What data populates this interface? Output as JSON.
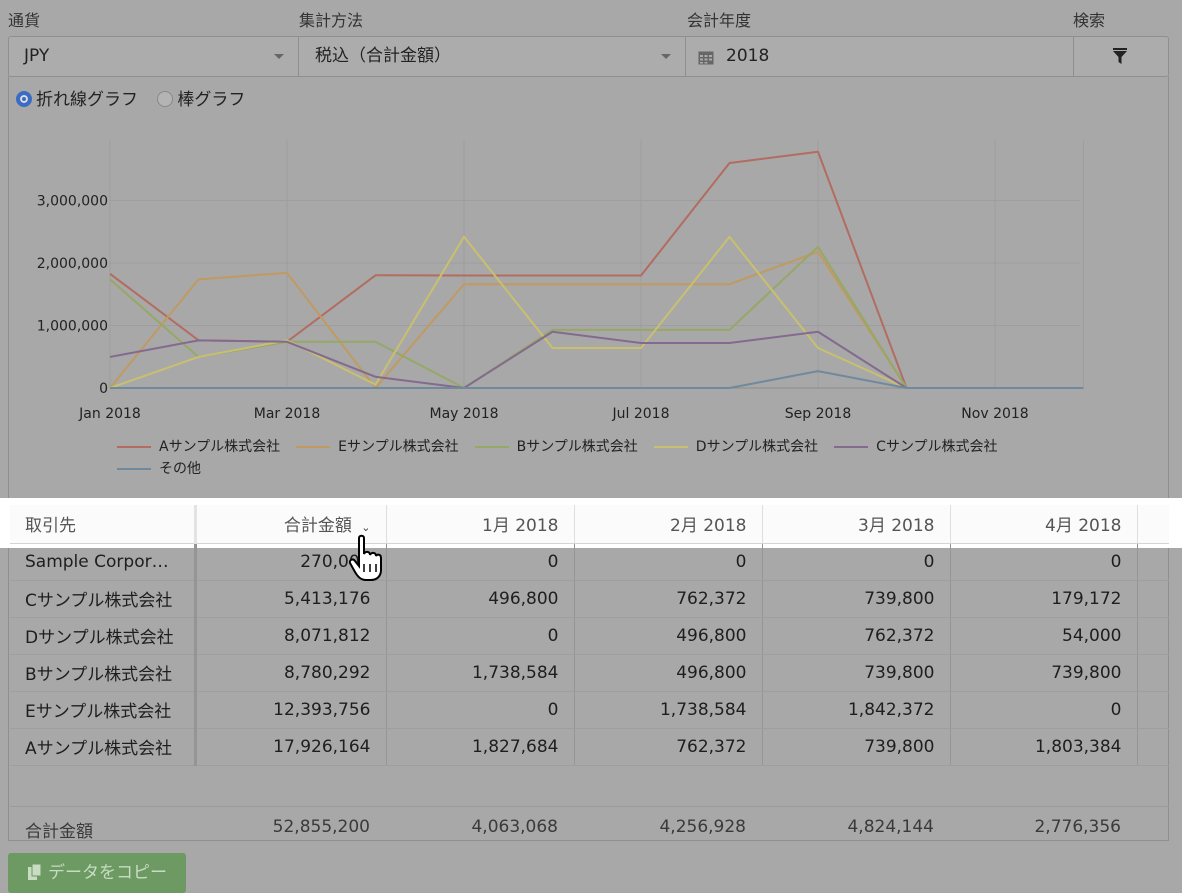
{
  "filters": {
    "labels": {
      "currency": "通貨",
      "method": "集計方法",
      "year": "会計年度",
      "search": "検索"
    },
    "currency_value": "JPY",
    "method_value": "税込（合計金額）",
    "year_value": "2018"
  },
  "chart_mode": {
    "line_label": "折れ線グラフ",
    "bar_label": "棒グラフ",
    "selected": "line"
  },
  "chart_data": {
    "type": "line",
    "x": [
      "2018-01",
      "2018-02",
      "2018-03",
      "2018-04",
      "2018-05",
      "2018-06",
      "2018-07",
      "2018-08",
      "2018-09",
      "2018-10",
      "2018-11",
      "2018-12"
    ],
    "x_tick_labels": [
      "Jan 2018",
      "Mar 2018",
      "May 2018",
      "Jul 2018",
      "Sep 2018",
      "Nov 2018"
    ],
    "y_tick_labels": [
      "0",
      "1,000,000",
      "2,000,000",
      "3,000,000"
    ],
    "ylim": [
      0,
      4000000
    ],
    "grid": true,
    "legend_position": "bottom",
    "series": [
      {
        "name": "Aサンプル株式会社",
        "color": "#b26c60",
        "values": [
          1827684,
          762372,
          739800,
          1803384,
          1800000,
          1800000,
          1800000,
          3600000,
          3780000,
          0,
          0,
          0
        ]
      },
      {
        "name": "Eサンプル株式会社",
        "color": "#c09a60",
        "values": [
          0,
          1738584,
          1842372,
          0,
          1660000,
          1660000,
          1660000,
          1660000,
          2180000,
          0,
          0,
          0
        ]
      },
      {
        "name": "Bサンプル株式会社",
        "color": "#96a866",
        "values": [
          1738584,
          496800,
          739800,
          739800,
          0,
          930000,
          930000,
          930000,
          2260000,
          0,
          0,
          0
        ]
      },
      {
        "name": "Dサンプル株式会社",
        "color": "#c8c06e",
        "values": [
          0,
          496800,
          762372,
          54000,
          2420000,
          640000,
          640000,
          2420000,
          640000,
          0,
          0,
          0
        ]
      },
      {
        "name": "Cサンプル株式会社",
        "color": "#846a8e",
        "values": [
          496800,
          762372,
          739800,
          179172,
          0,
          900000,
          720000,
          720000,
          900000,
          0,
          0,
          0
        ]
      },
      {
        "name": "その他",
        "color": "#6f8a9c",
        "values": [
          0,
          0,
          0,
          0,
          0,
          0,
          0,
          0,
          270000,
          0,
          0,
          0
        ]
      }
    ]
  },
  "table": {
    "headers": [
      "取引先",
      "合計金額",
      "1月 2018",
      "2月 2018",
      "3月 2018",
      "4月 2018"
    ],
    "rows": [
      [
        "Sample Corpor…",
        "270,000",
        "0",
        "0",
        "0",
        "0"
      ],
      [
        "Cサンプル株式会社",
        "5,413,176",
        "496,800",
        "762,372",
        "739,800",
        "179,172"
      ],
      [
        "Dサンプル株式会社",
        "8,071,812",
        "0",
        "496,800",
        "762,372",
        "54,000"
      ],
      [
        "Bサンプル株式会社",
        "8,780,292",
        "1,738,584",
        "496,800",
        "739,800",
        "739,800"
      ],
      [
        "Eサンプル株式会社",
        "12,393,756",
        "0",
        "1,738,584",
        "1,842,372",
        "0"
      ],
      [
        "Aサンプル株式会社",
        "17,926,164",
        "1,827,684",
        "762,372",
        "739,800",
        "1,803,384"
      ]
    ],
    "total": [
      "合計金額",
      "52,855,200",
      "4,063,068",
      "4,256,928",
      "4,824,144",
      "2,776,356"
    ]
  },
  "copy_button_label": "データをコピー",
  "icons": {
    "dropdown": "chevron-down-icon",
    "calendar": "calendar-icon",
    "filter": "filter-icon",
    "sort": "sort-desc-icon",
    "copy": "clipboard-icon",
    "cursor": "hand-pointer-icon"
  }
}
